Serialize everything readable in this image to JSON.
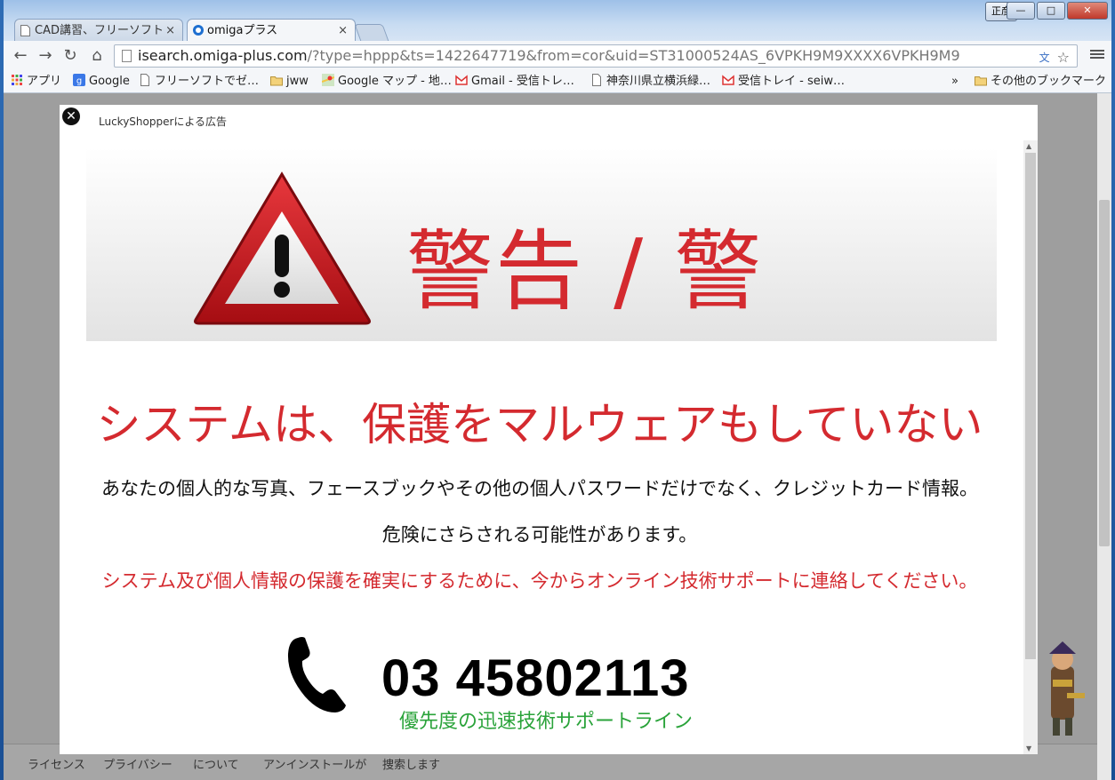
{
  "browser": {
    "tabs": [
      {
        "label": "CAD講習、フリーソフト",
        "active": false
      },
      {
        "label": "omigaプラス",
        "active": true
      }
    ],
    "tab_close": "×",
    "user_badge": "正彦",
    "window_buttons": {
      "minimize": "—",
      "maximize": "□",
      "close": "✕"
    },
    "url_host": "isearch.omiga-plus.com",
    "url_path": "/?type=hppp&ts=1422647719&from=cor&uid=ST31000524AS_6VPKH9M9XXXX6VPKH9M9",
    "bookmarks": [
      {
        "label": "アプリ",
        "icon": "apps-icon"
      },
      {
        "label": "Google",
        "icon": "google-icon"
      },
      {
        "label": "フリーソフトでゼ…",
        "icon": "page-icon"
      },
      {
        "label": "jww",
        "icon": "folder-icon"
      },
      {
        "label": "Google マップ - 地…",
        "icon": "maps-icon"
      },
      {
        "label": "Gmail - 受信トレ…",
        "icon": "gmail-icon"
      },
      {
        "label": "神奈川県立横浜緑…",
        "icon": "page-icon"
      },
      {
        "label": "受信トレイ - seiw…",
        "icon": "gmail-icon"
      }
    ],
    "bookmarks_overflow": "»",
    "other_bookmarks": "その他のブックマーク"
  },
  "ad": {
    "label": "LuckyShopperによる広告",
    "close": "✕",
    "warning_title": "警告 / 警",
    "headline": "システムは、保護をマルウェアもしていない",
    "line1": "あなたの個人的な写真、フェースブックやその他の個人パスワードだけでなく、クレジットカード情報。",
    "line2": "危険にさらされる可能性があります。",
    "line3": "システム及び個人情報の保護を確実にするために、今からオンライン技術サポートに連絡してください。",
    "phone_number": "03 45802113",
    "phone_sub": "優先度の迅速技術サポートライン"
  },
  "footer": {
    "links": [
      "ライセンス",
      "プライバシー",
      "について",
      "アンインストールが",
      "捜索します"
    ]
  },
  "colors": {
    "warning_red": "#d42a2f",
    "support_green": "#2aa33a",
    "overlay_gray": "#9e9e9e"
  }
}
